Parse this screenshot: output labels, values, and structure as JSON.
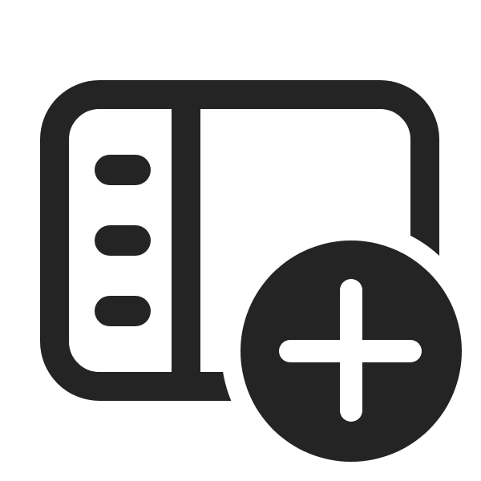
{
  "icon": {
    "name": "panel-left-add-icon",
    "color": "#242424",
    "background": "#ffffff"
  }
}
